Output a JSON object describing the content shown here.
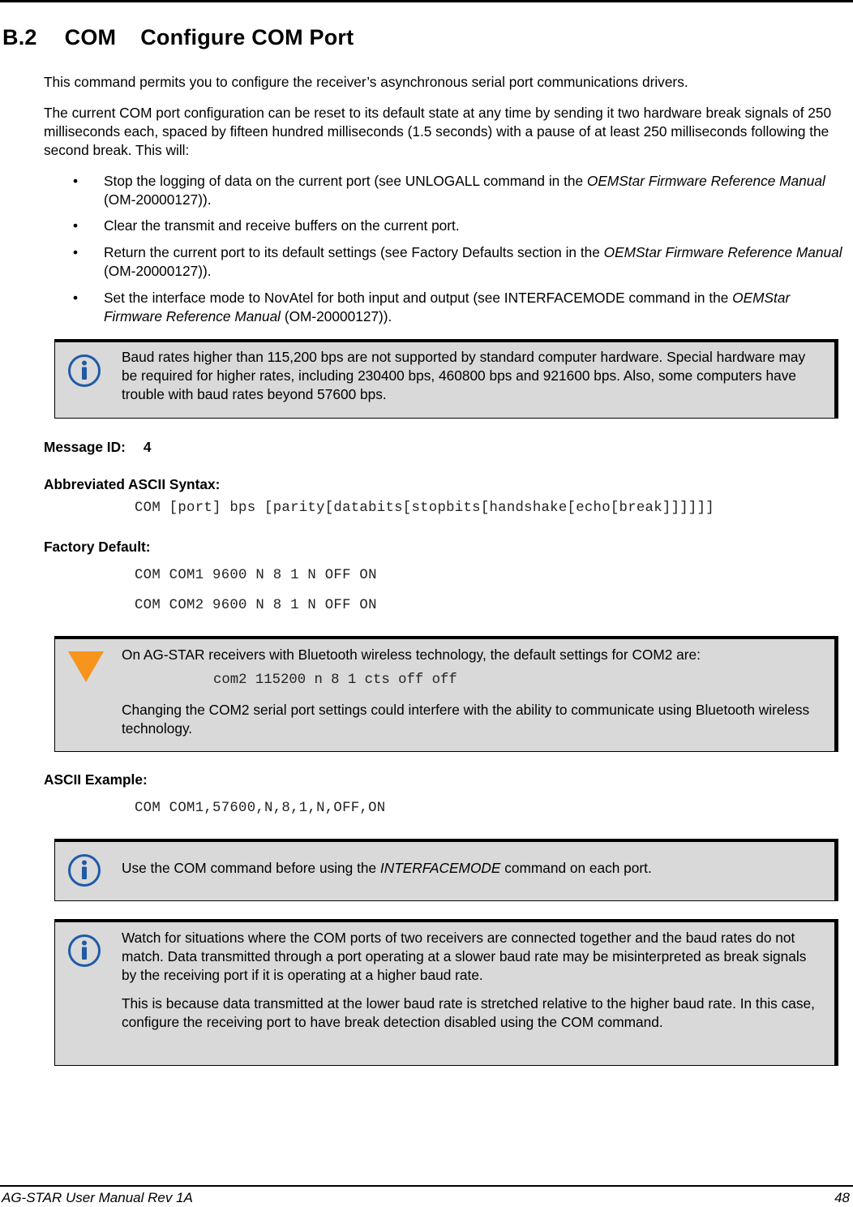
{
  "section": {
    "number": "B.2",
    "command": "COM",
    "title": "Configure COM Port"
  },
  "intro": "This command permits you to configure the receiver’s asynchronous serial port communications drivers.",
  "reset_paragraph": "The current COM port configuration can be reset to its default state at any time by sending it two hardware break signals of 250 milliseconds each, spaced by fifteen hundred milliseconds (1.5 seconds) with a pause of at least 250 milliseconds following the second break. This will:",
  "bullets": [
    {
      "pre": "Stop the logging of data on the current port (see UNLOGALL command in the ",
      "ital": "OEMStar Firmware Reference Manual",
      "post": " (OM-20000127))."
    },
    {
      "pre": "Clear the transmit and receive buffers on the current port.",
      "ital": "",
      "post": ""
    },
    {
      "pre": "Return the current port to its default settings (see Factory Defaults section in the ",
      "ital": "OEMStar Firmware Reference Manual",
      "post": " (OM-20000127))."
    },
    {
      "pre": "Set the interface mode to NovAtel for both input and output (see INTERFACEMODE command in the ",
      "ital": "OEMStar Firmware Reference Manual",
      "post": " (OM-20000127))."
    }
  ],
  "notes": {
    "baud": {
      "icon": "info-icon",
      "text": "Baud rates higher than 115,200 bps are not supported by standard computer hardware. Special hardware may be required for higher rates, including 230400 bps, 460800 bps and 921600 bps. Also, some computers have trouble with baud rates beyond 57600 bps."
    },
    "bluetooth": {
      "icon": "warning-triangle-icon",
      "line1": "On AG-STAR receivers with Bluetooth wireless technology, the default settings for COM2 are:",
      "code": "com2 115200 n 8 1 cts off off",
      "line2": "Changing the COM2 serial port settings could interfere with the ability to communicate using Bluetooth wireless technology."
    },
    "interfacemode": {
      "icon": "info-icon",
      "pre": "Use the COM command before using the ",
      "ital": "INTERFACEMODE",
      "post": " command on each port."
    },
    "mismatch": {
      "icon": "info-icon",
      "p1": "Watch for situations where the COM ports of two receivers are connected together and the baud rates do not match. Data transmitted through a port operating at a slower baud rate may be misinterpreted as break signals by the receiving port if it is operating at a higher baud rate.",
      "p2": "This is because data transmitted at the lower baud rate is stretched relative to the higher baud rate. In this case, configure the receiving port to have break detection disabled using the COM command."
    }
  },
  "message_id": {
    "label": "Message ID:",
    "value": "4"
  },
  "syntax": {
    "label": "Abbreviated ASCII Syntax:",
    "code": "COM [port] bps [parity[databits[stopbits[handshake[echo[break]]]]]]"
  },
  "factory_default": {
    "label": "Factory Default:",
    "lines": [
      "COM COM1 9600 N 8 1 N OFF ON",
      "COM COM2 9600 N 8 1 N OFF ON"
    ]
  },
  "ascii_example": {
    "label": "ASCII Example:",
    "code": "COM COM1,57600,N,8,1,N,OFF,ON"
  },
  "footer": {
    "left": "AG-STAR User Manual Rev 1A",
    "page": "48"
  },
  "colors": {
    "info_icon": "#1f5aa6",
    "warning_icon": "#f7941d",
    "note_bg": "#d9d9d9"
  }
}
